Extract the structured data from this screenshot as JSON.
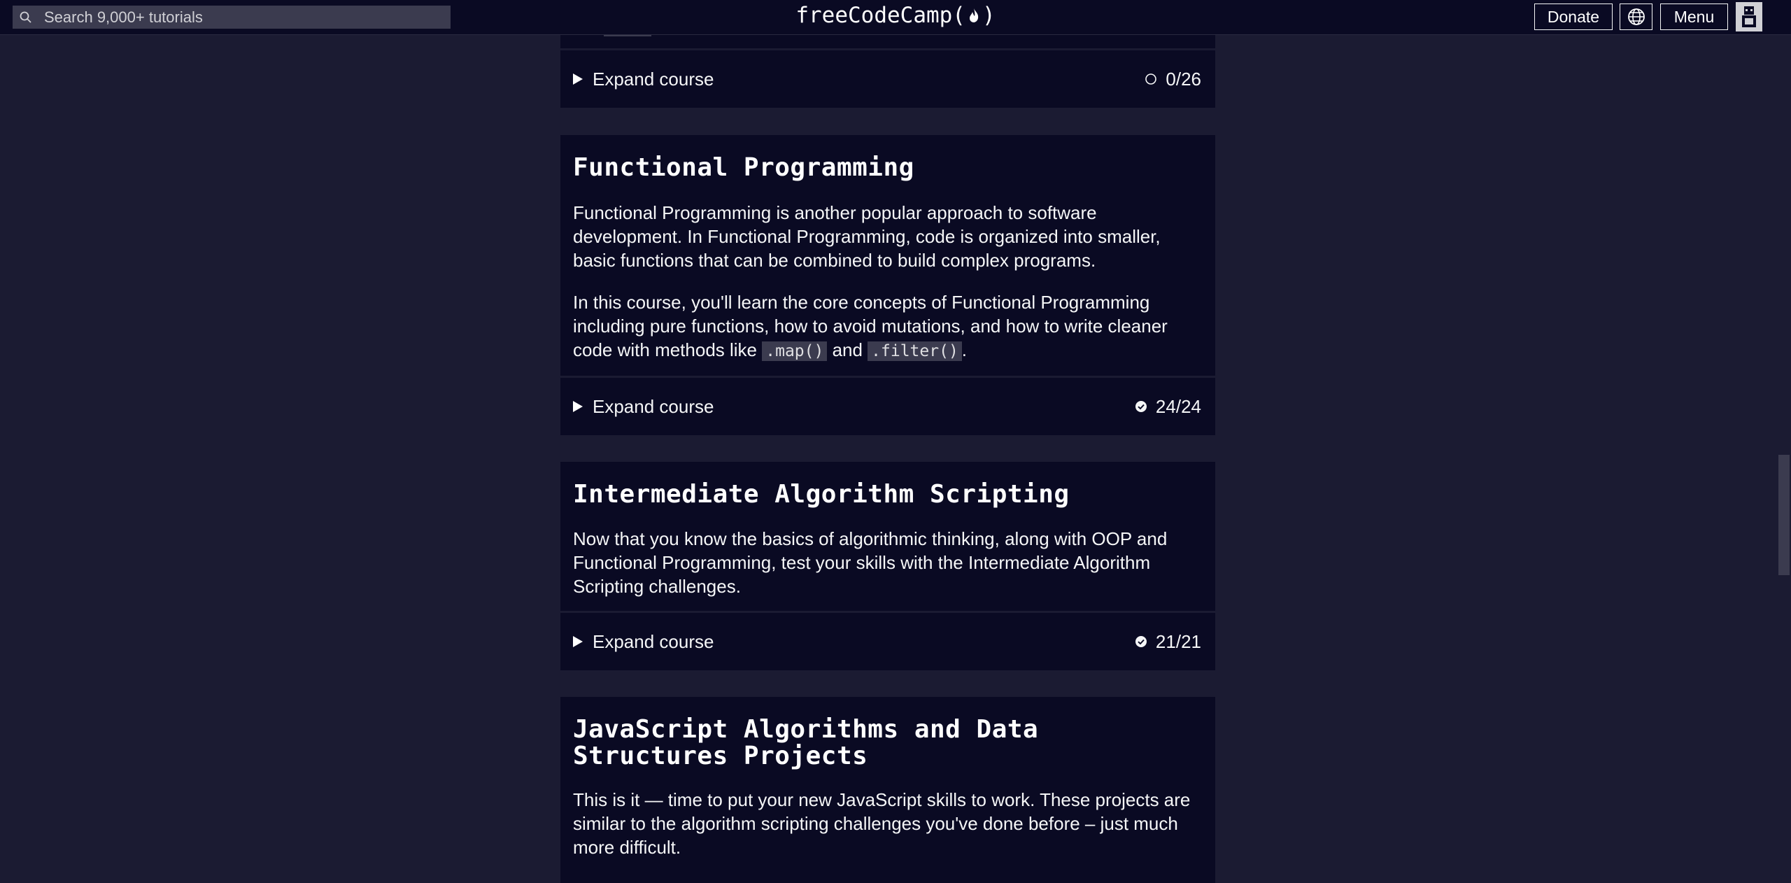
{
  "nav": {
    "search_placeholder": "Search 9,000+ tutorials",
    "logo_left": "freeCodeCamp(",
    "logo_right": ")",
    "donate": "Donate",
    "menu": "Menu"
  },
  "colors": {
    "page_bg": "#1b1b32",
    "card_bg": "#0a0a23",
    "code_bg": "#3b3b4f",
    "text": "#f5f6f7"
  },
  "prev_course": {
    "expand_label": "Expand course",
    "progress": "0/26",
    "status_icon": "empty-circle-icon"
  },
  "courses": [
    {
      "title": "Functional Programming",
      "paragraph1": "Functional Programming is another popular approach to software development. In Functional Programming, code is organized into smaller, basic functions that can be combined to build complex programs.",
      "p2_text1": "In this course, you'll learn the core concepts of Functional Programming including pure functions, how to avoid mutations, and how to write cleaner code with methods like ",
      "p2_code1": ".map()",
      "p2_text2": " and ",
      "p2_code2": ".filter()",
      "p2_text3": ".",
      "expand_label": "Expand course",
      "progress": "24/24",
      "status_icon": "check-circle-icon"
    },
    {
      "title": "Intermediate Algorithm Scripting",
      "paragraph1": "Now that you know the basics of algorithmic thinking, along with OOP and Functional Programming, test your skills with the Intermediate Algorithm Scripting challenges.",
      "expand_label": "Expand course",
      "progress": "21/21",
      "status_icon": "check-circle-icon"
    },
    {
      "title": "JavaScript Algorithms and Data Structures Projects",
      "paragraph1": "This is it — time to put your new JavaScript skills to work. These projects are similar to the algorithm scripting challenges you've done before – just much more difficult."
    }
  ]
}
